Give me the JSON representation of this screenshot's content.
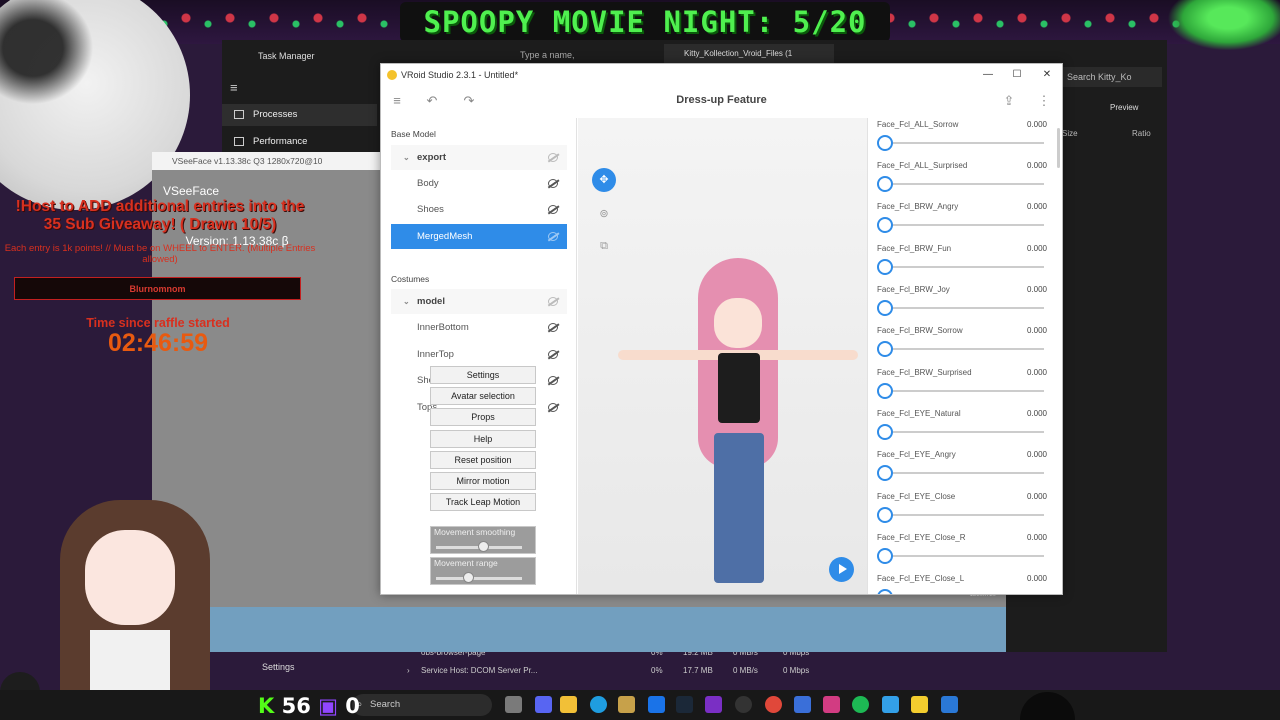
{
  "overlay": {
    "banner_title": "SPOOPY MOVIE NIGHT: 5/20",
    "giveaway_line1": "!Host to ADD additional entries into the",
    "giveaway_line2": "35 Sub Giveaway! ( Drawn 10/5)",
    "giveaway_sub": "Each entry is 1k points! // Must be on WHEEL to ENTER. (Multiple Entries allowed)",
    "winner_name": "Blurnomnom",
    "raffle_label": "Time since raffle started",
    "raffle_timer": "02:46:59",
    "kick_count": "56",
    "twitch_count": "0"
  },
  "task_manager": {
    "title": "Task Manager",
    "search_placeholder": "Type a name, publisher,...",
    "explorer_tab": "Kitty_Kollection_Vroid_Files (1",
    "right_search": "Search Kitty_Ko",
    "preview_label": "Preview",
    "col_size": "Size",
    "col_ratio": "Ratio",
    "nav": [
      {
        "label": "Processes"
      },
      {
        "label": "Performance"
      }
    ],
    "rows": [
      {
        "name": "obs-browser-page",
        "cpu": "0%",
        "mem": "19.2 MB",
        "disk": "0 MB/s",
        "net": "0 Mbps"
      },
      {
        "name": "Service Host: DCOM Server Pr...",
        "cpu": "0%",
        "mem": "17.7 MB",
        "disk": "0 MB/s",
        "net": "0 Mbps"
      }
    ],
    "settings_label": "Settings"
  },
  "vseeface": {
    "window_title": "VSeeFace v1.13.38c Q3 1280x720@10",
    "name": "VSeeFace",
    "version": "Version: 1.13.38c β",
    "menu": [
      {
        "label": "Settings"
      },
      {
        "label": "Avatar selection"
      },
      {
        "label": "Props"
      },
      {
        "label": "Help"
      },
      {
        "label": "Reset position"
      },
      {
        "label": "Mirror motion"
      },
      {
        "label": "Track Leap Motion"
      }
    ],
    "sliders": [
      {
        "label": "Movement smoothing",
        "value": 0.55
      },
      {
        "label": "Movement range",
        "value": 0.37
      }
    ],
    "resolution": "1280x720"
  },
  "vroid": {
    "window_title": "VRoid Studio 2.3.1 - Untitled*",
    "page_title": "Dress-up Feature",
    "base_model_label": "Base Model",
    "costumes_label": "Costumes",
    "base_model": {
      "group": "export",
      "items": [
        {
          "label": "Body"
        },
        {
          "label": "Shoes"
        },
        {
          "label": "MergedMesh"
        }
      ]
    },
    "costumes": {
      "group": "model",
      "items": [
        {
          "label": "InnerBottom"
        },
        {
          "label": "InnerTop"
        },
        {
          "label": "Shoes"
        },
        {
          "label": "Tops"
        }
      ]
    },
    "blendshapes": [
      {
        "name": "Face_Fcl_ALL_Sorrow",
        "value": "0.000"
      },
      {
        "name": "Face_Fcl_ALL_Surprised",
        "value": "0.000"
      },
      {
        "name": "Face_Fcl_BRW_Angry",
        "value": "0.000"
      },
      {
        "name": "Face_Fcl_BRW_Fun",
        "value": "0.000"
      },
      {
        "name": "Face_Fcl_BRW_Joy",
        "value": "0.000"
      },
      {
        "name": "Face_Fcl_BRW_Sorrow",
        "value": "0.000"
      },
      {
        "name": "Face_Fcl_BRW_Surprised",
        "value": "0.000"
      },
      {
        "name": "Face_Fcl_EYE_Natural",
        "value": "0.000"
      },
      {
        "name": "Face_Fcl_EYE_Angry",
        "value": "0.000"
      },
      {
        "name": "Face_Fcl_EYE_Close",
        "value": "0.000"
      },
      {
        "name": "Face_Fcl_EYE_Close_R",
        "value": "0.000"
      },
      {
        "name": "Face_Fcl_EYE_Close_L",
        "value": "0.000"
      }
    ],
    "accent_color": "#2f8ce8"
  },
  "taskbar": {
    "search_label": "Search"
  }
}
